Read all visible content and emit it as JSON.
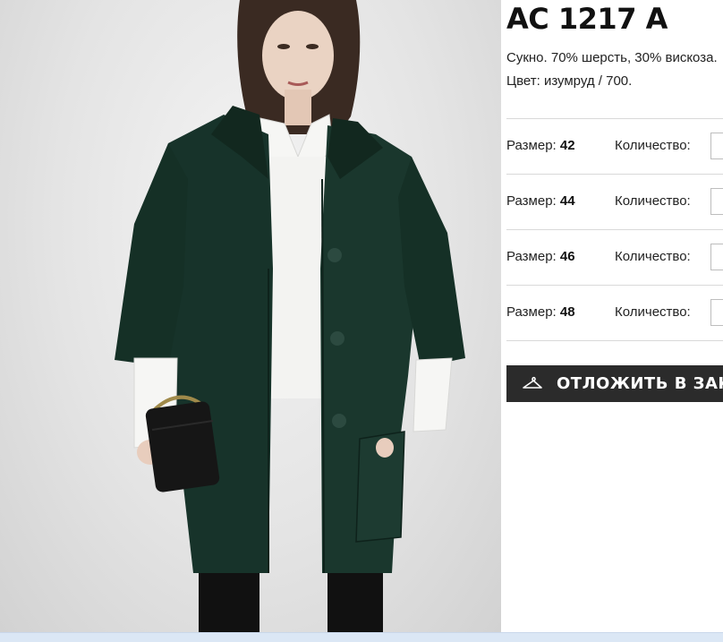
{
  "product": {
    "title": "AC 1217 A",
    "material": "Сукно. 70% шерсть, 30% вискоза.",
    "color": "Цвет: изумруд / 700."
  },
  "sizes": {
    "size_label": "Размер: ",
    "quantity_label": "Количество:",
    "items": [
      {
        "size": "42",
        "quantity": ""
      },
      {
        "size": "44",
        "quantity": ""
      },
      {
        "size": "46",
        "quantity": ""
      },
      {
        "size": "48",
        "quantity": ""
      }
    ]
  },
  "actions": {
    "reserve_label": "ОТЛОЖИТЬ В ЗАКАЗ",
    "reserve_icon": "hanger-icon"
  },
  "photo": {
    "subject": "model-in-emerald-coat",
    "coat_color": "#17332a",
    "shirt_color": "#f6f6f4",
    "bag_color": "#161616"
  }
}
